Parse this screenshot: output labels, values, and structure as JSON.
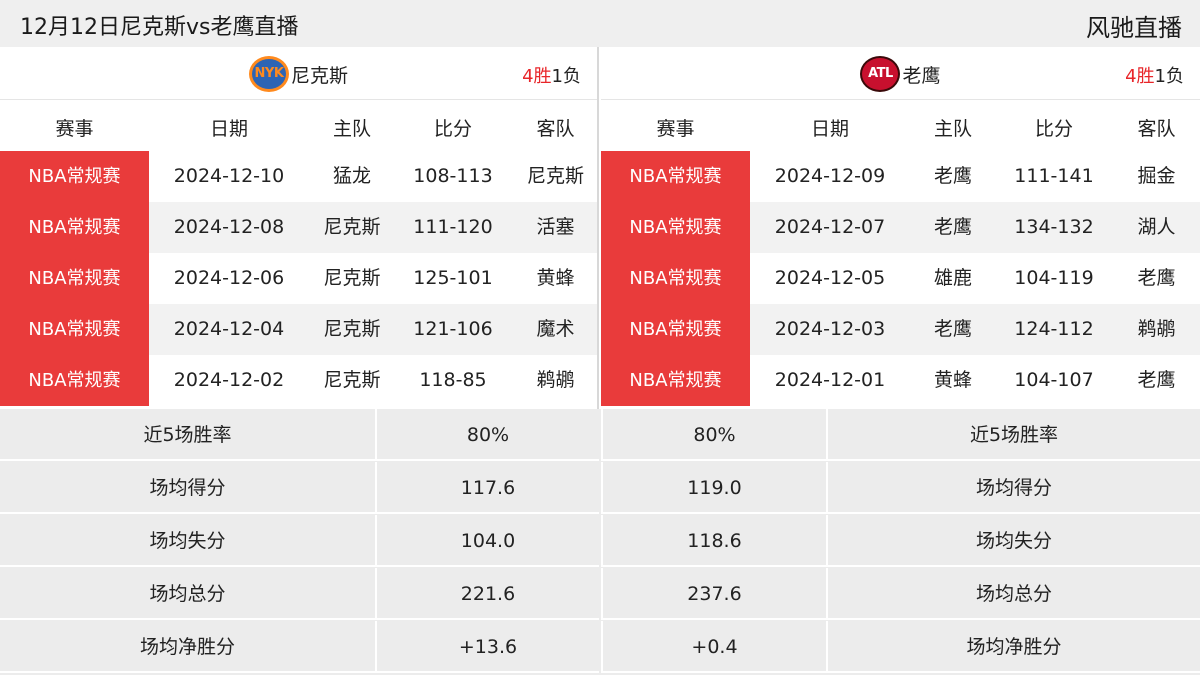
{
  "header": {
    "title": "12月12日尼克斯vs老鹰直播",
    "brand": "风驰直播"
  },
  "columns": {
    "league": "赛事",
    "date": "日期",
    "home": "主队",
    "score": "比分",
    "away": "客队"
  },
  "left_team": {
    "logo_text": "NYK",
    "name": "尼克斯",
    "record_wins": "4胜",
    "record_losses": "1负",
    "games": [
      {
        "league": "NBA常规赛",
        "date": "2024-12-10",
        "home": "猛龙",
        "score": "108-113",
        "away": "尼克斯"
      },
      {
        "league": "NBA常规赛",
        "date": "2024-12-08",
        "home": "尼克斯",
        "score": "111-120",
        "away": "活塞"
      },
      {
        "league": "NBA常规赛",
        "date": "2024-12-06",
        "home": "尼克斯",
        "score": "125-101",
        "away": "黄蜂"
      },
      {
        "league": "NBA常规赛",
        "date": "2024-12-04",
        "home": "尼克斯",
        "score": "121-106",
        "away": "魔术"
      },
      {
        "league": "NBA常规赛",
        "date": "2024-12-02",
        "home": "尼克斯",
        "score": "118-85",
        "away": "鹈鹕"
      }
    ]
  },
  "right_team": {
    "logo_text": "ATL",
    "name": "老鹰",
    "record_wins": "4胜",
    "record_losses": "1负",
    "games": [
      {
        "league": "NBA常规赛",
        "date": "2024-12-09",
        "home": "老鹰",
        "score": "111-141",
        "away": "掘金"
      },
      {
        "league": "NBA常规赛",
        "date": "2024-12-07",
        "home": "老鹰",
        "score": "134-132",
        "away": "湖人"
      },
      {
        "league": "NBA常规赛",
        "date": "2024-12-05",
        "home": "雄鹿",
        "score": "104-119",
        "away": "老鹰"
      },
      {
        "league": "NBA常规赛",
        "date": "2024-12-03",
        "home": "老鹰",
        "score": "124-112",
        "away": "鹈鹕"
      },
      {
        "league": "NBA常规赛",
        "date": "2024-12-01",
        "home": "黄蜂",
        "score": "104-107",
        "away": "老鹰"
      }
    ]
  },
  "stats": [
    {
      "label": "近5场胜率",
      "left": "80%",
      "right": "80%"
    },
    {
      "label": "场均得分",
      "left": "117.6",
      "right": "119.0"
    },
    {
      "label": "场均失分",
      "left": "104.0",
      "right": "118.6"
    },
    {
      "label": "场均总分",
      "left": "221.6",
      "right": "237.6"
    },
    {
      "label": "场均净胜分",
      "left": "+13.6",
      "right": "+0.4"
    }
  ],
  "colors": {
    "accent_red": "#e93b3b",
    "win_red": "#e8262a",
    "header_bg": "#efefef",
    "stats_bg": "#ececec"
  }
}
